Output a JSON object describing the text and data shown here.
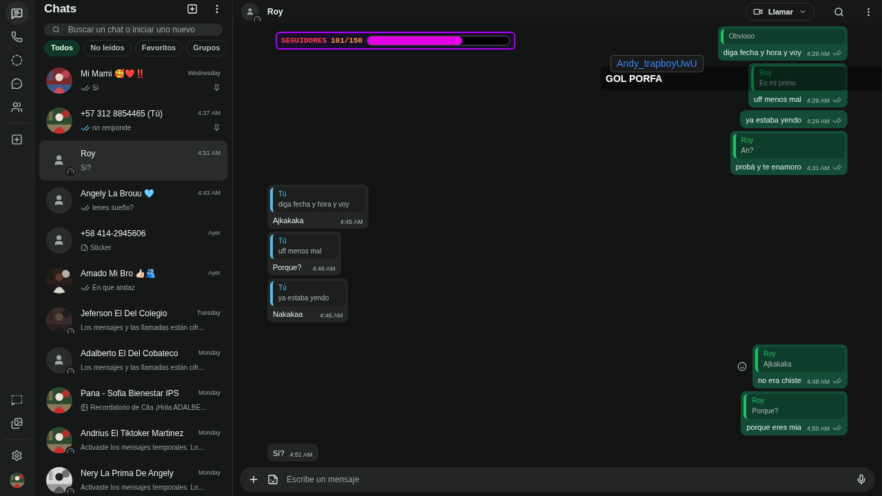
{
  "rail": {
    "top": [
      {
        "selected": true
      },
      {
        "selected": false
      },
      {
        "selected": false
      },
      {
        "selected": false
      },
      {
        "selected": false
      },
      {
        "selected": false
      }
    ],
    "bottom": [
      {
        "selected": false
      },
      {
        "selected": false
      },
      {
        "selected": false
      }
    ]
  },
  "sidebar": {
    "title": "Chats",
    "search": {
      "placeholder": "Buscar un chat o iniciar uno nuevo"
    },
    "filters": [
      {
        "label": "Todos",
        "selected": true
      },
      {
        "label": "No leídos",
        "selected": false
      },
      {
        "label": "Favoritos",
        "selected": false
      },
      {
        "label": "Grupos",
        "selected": false
      }
    ],
    "chats": [
      {
        "name": "Mi Mami 🥰❤️‼️",
        "preview": "Si",
        "time": "Wednesday",
        "double_tick": true,
        "read": false,
        "pinned": true,
        "photo": true,
        "status_ring": false,
        "selected": false
      },
      {
        "name": "+57 312 8854465 (Tú)",
        "preview": "no renponde",
        "time": "4:37 AM",
        "double_tick": true,
        "read": true,
        "pinned": true,
        "photo": true,
        "status_ring": false,
        "selected": false
      },
      {
        "name": "Roy",
        "preview": "Sí?",
        "time": "4:51 AM",
        "photo": false,
        "status_ring": true,
        "selected": true
      },
      {
        "name": "Angely La Brouu 🩵",
        "preview": "tenes sueño?",
        "time": "4:43 AM",
        "double_tick": true,
        "read": false,
        "photo": false,
        "status_ring": false,
        "selected": false
      },
      {
        "name": "+58 414-2945606",
        "preview": "Sticker",
        "sticker": true,
        "time": "Ayer",
        "photo": false,
        "status_ring": false,
        "selected": false
      },
      {
        "name": "Amado Mi Bro 👍🏻🫂",
        "preview": "En que andaz",
        "time": "Ayer",
        "double_tick": true,
        "read": false,
        "photo": true,
        "status_ring": false,
        "selected": false
      },
      {
        "name": "Jeferson El Del Colegio",
        "preview": "Los mensajes y las llamadas están cifr...",
        "time": "Tuesday",
        "photo": true,
        "status_ring": true,
        "selected": false
      },
      {
        "name": "Adalberto El Del Cobateco",
        "preview": "Los mensajes y las llamadas están cifr...",
        "time": "Monday",
        "photo": false,
        "status_ring": true,
        "selected": false
      },
      {
        "name": "Pana - Sofia Bienestar IPS",
        "preview": "Recordatorio de Cita ¡Hola ADALBE...",
        "image_attachment": true,
        "time": "Monday",
        "photo": true,
        "status_ring": false,
        "selected": false
      },
      {
        "name": "Andrius El Tiktoker Martinez",
        "preview": "Activaste los mensajes temporales. Lo...",
        "time": "Monday",
        "photo": true,
        "status_ring": true,
        "selected": false
      },
      {
        "name": "Nery La Prima De Angely",
        "preview": "Activaste los mensajes temporales. Lo...",
        "time": "Monday",
        "photo": true,
        "status_ring": true,
        "selected": false
      }
    ]
  },
  "conversation": {
    "contact": "Roy",
    "status_ring": true,
    "call_button": "Llamar",
    "composer": {
      "placeholder": "Escribe un mensaje"
    },
    "groups": [
      {
        "outgoing": true,
        "messages": [
          {
            "quote": {
              "text": "Obviooo"
            },
            "text": "diga fecha y hora y voy",
            "time": "4:28 AM",
            "read": false,
            "hovered": false
          },
          {
            "quote": {
              "author": "Roy",
              "text": "Es mi primo"
            },
            "text": "uff menos mal",
            "time": "4:29 AM",
            "read": false,
            "hovered": false
          },
          {
            "text": "ya estaba yendo",
            "time": "4:29 AM",
            "read": false,
            "hovered": false
          },
          {
            "quote": {
              "author": "Roy",
              "text": "Ah?"
            },
            "text": "probá y te enamoro",
            "time": "4:31 AM",
            "read": false,
            "hovered": false
          }
        ]
      },
      {
        "outgoing": false,
        "messages": [
          {
            "quote": {
              "author": "Tú",
              "text": "diga fecha y hora y voy"
            },
            "text": "Ajkakaka",
            "time": "4:45 AM",
            "hovered": false
          },
          {
            "quote": {
              "author": "Tú",
              "text": "uff menos mal"
            },
            "text": "Porque?",
            "time": "4:46 AM",
            "hovered": false
          },
          {
            "quote": {
              "author": "Tú",
              "text": "ya estaba yendo"
            },
            "text": "Nakakaa",
            "time": "4:46 AM",
            "hovered": false
          }
        ]
      },
      {
        "outgoing": true,
        "messages": [
          {
            "quote": {
              "author": "Roy",
              "text": "Ajkakaka"
            },
            "text": "no era chiste",
            "time": "4:48 AM",
            "read": false,
            "hovered": true
          },
          {
            "quote": {
              "author": "Roy",
              "text": "Porque?"
            },
            "text": "porque eres mia",
            "time": "4:50 AM",
            "read": false,
            "hovered": false
          }
        ]
      },
      {
        "outgoing": false,
        "messages": [
          {
            "text": "Sí?",
            "time": "4:51 AM",
            "hovered": false
          }
        ]
      }
    ]
  },
  "stream_overlay": {
    "followers_label": "SEGUIDORES",
    "followers_count": "101/150",
    "level": 0.67,
    "chat_user": "Andy_trapboyUwU",
    "chat_message": "GOL PORFA"
  }
}
